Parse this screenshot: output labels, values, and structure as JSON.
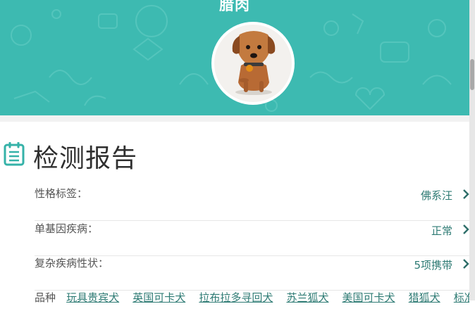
{
  "header": {
    "pet_name": "腊肉",
    "colors": {
      "banner": "#3dbab1",
      "accent": "#2e7b74",
      "icon": "#35b2a8"
    },
    "avatar_icon": "dachshund-photo"
  },
  "report": {
    "title": "检测报告",
    "icon": "clipboard-icon",
    "rows": [
      {
        "label": "性格标签：",
        "value": "佛系汪"
      },
      {
        "label": "单基因疾病：",
        "value": "正常"
      },
      {
        "label": "复杂疾病性状：",
        "value": "5项携带"
      }
    ],
    "breed_label": "品种",
    "breeds": [
      "玩具贵宾犬",
      "英国可卡犬",
      "拉布拉多寻回犬",
      "苏兰狐犬",
      "美国可卡犬",
      "猎狐犬",
      "标准"
    ]
  }
}
